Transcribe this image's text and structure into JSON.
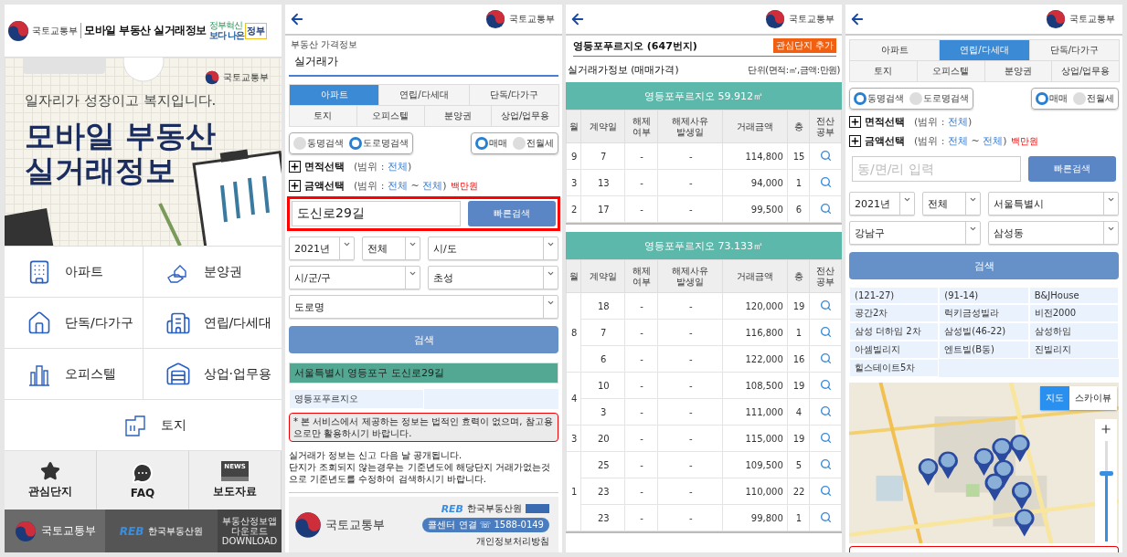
{
  "home": {
    "header": {
      "ministry": "국토교통부",
      "title": "모바일 부동산 실거래정보",
      "badge_small": "정부혁신",
      "badge_main": "보다 나은",
      "badge_accent": "정부"
    },
    "banner": {
      "ministry": "국토교통부",
      "slogan": "일자리가 성장이고 복지입니다.",
      "title_lines": [
        "모바일 부동산",
        "실거래정보"
      ]
    },
    "menu": [
      {
        "label": "아파트",
        "kind": "apartment"
      },
      {
        "label": "분양권",
        "kind": "presale"
      },
      {
        "label": "단독/다가구",
        "kind": "house"
      },
      {
        "label": "연립/다세대",
        "kind": "villa"
      },
      {
        "label": "오피스텔",
        "kind": "officetel"
      },
      {
        "label": "상업·업무용",
        "kind": "commercial"
      },
      {
        "label": "토지",
        "kind": "land"
      }
    ],
    "quick": [
      {
        "label": "관심단지",
        "kind": "star"
      },
      {
        "label": "FAQ",
        "kind": "chat"
      },
      {
        "label": "보도자료",
        "kind": "news",
        "icon_text": "NEWS"
      }
    ],
    "footer": {
      "ministry": "국토교통부",
      "reb": "REB",
      "reb_name": "한국부동산원",
      "app": "부동산정보앱 다운로드",
      "app_sub": "DOWNLOAD"
    }
  },
  "road_search": {
    "ministry": "국토교통부",
    "breadcrumb": "부동산 가격정보",
    "title": "실거래가",
    "tabs": [
      [
        {
          "label": "아파트",
          "selected": true
        },
        {
          "label": "연립/다세대",
          "selected": false
        },
        {
          "label": "단독/다가구",
          "selected": false
        }
      ],
      [
        {
          "label": "토지",
          "selected": false
        },
        {
          "label": "오피스텔",
          "selected": false
        },
        {
          "label": "분양권",
          "selected": false
        },
        {
          "label": "상업/업무용",
          "selected": false
        }
      ]
    ],
    "search_modes": [
      {
        "label": "동명검색",
        "selected": false
      },
      {
        "label": "도로명검색",
        "selected": true
      }
    ],
    "deal_types": [
      {
        "label": "매매",
        "selected": true
      },
      {
        "label": "전월세",
        "selected": false
      }
    ],
    "filters": [
      {
        "label": "면적선택",
        "range": "(범위 : **전체**)"
      },
      {
        "label": "금액선택",
        "range": "(범위 : **전체** ~ **전체**)",
        "unit": "백만원"
      }
    ],
    "query": {
      "value": "도신로29길",
      "highlighted": true
    },
    "quick_button": "빠른검색",
    "selects": [
      [
        "2021년",
        "전체",
        "시/도"
      ],
      [
        "시/군/구",
        "초성"
      ],
      [
        "도로명"
      ]
    ],
    "search_button": "검색",
    "result_header": "서울특별시 영등포구 도신로29길",
    "results": [
      "영등포푸르지오"
    ],
    "notice": "* 본 서비스에서 제공하는 정보는 법적인 효력이 없으며, 참고용으로만 활용하시기 바랍니다.",
    "info": [
      "실거래가 정보는 신고 다음 날 공개됩니다.",
      "단지가 조회되지 않는경우는 기준년도에 해당단지 거래가없는것으로 기준년도를 수정하여 검색하시기 바랍니다."
    ],
    "footer": {
      "reb": "REB",
      "reb_name": "한국부동산원",
      "ministry": "국토교통부",
      "call": "콜센터 연결 ☏ 1588-0149",
      "privacy": "개인정보처리방침"
    }
  },
  "detail": {
    "ministry": "국토교통부",
    "title": "영등포푸르지오 (647번지)",
    "favorite_button": "관심단지 추가",
    "section": "실거래가정보 (매매가격)",
    "unit": "단위(면적:㎡,금액:만원)",
    "tables": [
      {
        "title": "영등포푸르지오 59.912㎡",
        "columns": [
          "월",
          "계약일",
          "해제\n여부",
          "해제사유\n발생일",
          "거래금액",
          "층",
          "전산\n공부"
        ],
        "groups": [
          {
            "month": "9",
            "rows": [
              {
                "day": "7",
                "cancel": "-",
                "cancel_date": "-",
                "price": "114,800",
                "floor": "15"
              }
            ]
          },
          {
            "month": "3",
            "rows": [
              {
                "day": "13",
                "cancel": "-",
                "cancel_date": "-",
                "price": "94,000",
                "floor": "1"
              }
            ]
          },
          {
            "month": "2",
            "rows": [
              {
                "day": "17",
                "cancel": "-",
                "cancel_date": "-",
                "price": "99,500",
                "floor": "6"
              }
            ]
          }
        ]
      },
      {
        "title": "영등포푸르지오 73.133㎡",
        "columns": [
          "월",
          "계약일",
          "해제\n여부",
          "해제사유\n발생일",
          "거래금액",
          "층",
          "전산\n공부"
        ],
        "groups": [
          {
            "month": "8",
            "rows": [
              {
                "day": "18",
                "cancel": "-",
                "cancel_date": "-",
                "price": "120,000",
                "floor": "19"
              },
              {
                "day": "7",
                "cancel": "-",
                "cancel_date": "-",
                "price": "116,800",
                "floor": "1"
              },
              {
                "day": "6",
                "cancel": "-",
                "cancel_date": "-",
                "price": "122,000",
                "floor": "16"
              }
            ]
          },
          {
            "month": "4",
            "rows": [
              {
                "day": "10",
                "cancel": "-",
                "cancel_date": "-",
                "price": "108,500",
                "floor": "19"
              },
              {
                "day": "3",
                "cancel": "-",
                "cancel_date": "-",
                "price": "111,000",
                "floor": "4"
              }
            ]
          },
          {
            "month": "3",
            "rows": [
              {
                "day": "20",
                "cancel": "-",
                "cancel_date": "-",
                "price": "115,000",
                "floor": "19"
              }
            ]
          },
          {
            "month": "1",
            "rows": [
              {
                "day": "25",
                "cancel": "-",
                "cancel_date": "-",
                "price": "109,500",
                "floor": "5"
              },
              {
                "day": "23",
                "cancel": "-",
                "cancel_date": "-",
                "price": "110,000",
                "floor": "22"
              },
              {
                "day": "23",
                "cancel": "-",
                "cancel_date": "-",
                "price": "99,800",
                "floor": "1"
              }
            ]
          }
        ]
      }
    ]
  },
  "dong_search": {
    "ministry": "국토교통부",
    "tabs": [
      [
        {
          "label": "아파트",
          "selected": false
        },
        {
          "label": "연립/다세대",
          "selected": true
        },
        {
          "label": "단독/다가구",
          "selected": false
        }
      ],
      [
        {
          "label": "토지",
          "selected": false
        },
        {
          "label": "오피스텔",
          "selected": false
        },
        {
          "label": "분양권",
          "selected": false
        },
        {
          "label": "상업/업무용",
          "selected": false
        }
      ]
    ],
    "search_modes": [
      {
        "label": "동명검색",
        "selected": true
      },
      {
        "label": "도로명검색",
        "selected": false
      }
    ],
    "deal_types": [
      {
        "label": "매매",
        "selected": true
      },
      {
        "label": "전월세",
        "selected": false
      }
    ],
    "filters": [
      {
        "label": "면적선택",
        "range": "(범위 : **전체**)"
      },
      {
        "label": "금액선택",
        "range": "(범위 : **전체** ~ **전체**)",
        "unit": "백만원"
      }
    ],
    "query": {
      "placeholder": "동/면/리 입력",
      "highlighted": false
    },
    "quick_button": "빠른검색",
    "selects": [
      [
        "2021년",
        "전체",
        "서울특별시"
      ],
      [
        "강남구",
        "삼성동"
      ]
    ],
    "search_button": "검색",
    "results": [
      "(121-27)",
      "(91-14)",
      "B&JHouse",
      "공간2차",
      "럭키금성빌라",
      "비전2000",
      "삼성 더하임 2차",
      "삼성빌(46-22)",
      "삼성하임",
      "아셈빌리지",
      "엔트빌(B동)",
      "진빌리지",
      "힐스테이트5차"
    ],
    "map": {
      "views": [
        {
          "label": "지도",
          "selected": true
        },
        {
          "label": "스카이뷰",
          "selected": false
        }
      ],
      "zoom": {
        "level": 0.7
      }
    }
  }
}
